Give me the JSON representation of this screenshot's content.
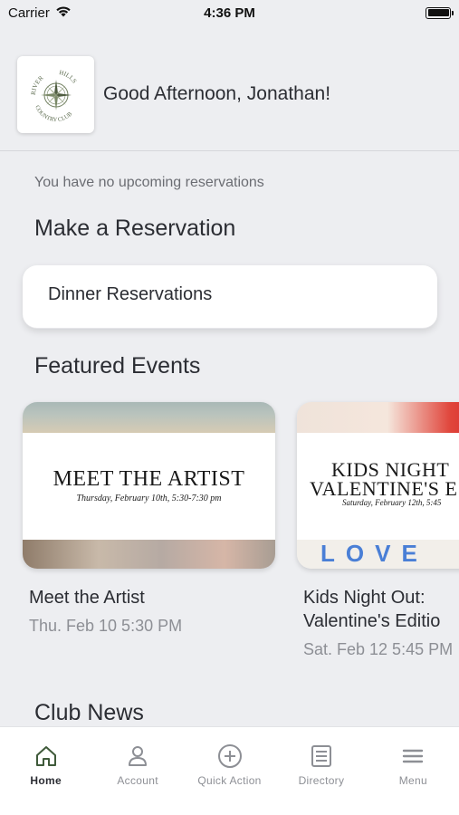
{
  "status": {
    "carrier": "Carrier",
    "time": "4:36 PM"
  },
  "header": {
    "greeting": "Good Afternoon, Jonathan!",
    "logo": {
      "top": "RIVER",
      "right": "HILLS",
      "bottom": "COUNTRY CLUB"
    }
  },
  "reservations": {
    "empty_text": "You have no upcoming reservations",
    "section_title": "Make a Reservation",
    "items": [
      {
        "label": "Dinner Reservations"
      }
    ]
  },
  "events": {
    "section_title": "Featured Events",
    "items": [
      {
        "banner_title": "MEET THE ARTIST",
        "banner_sub": "Thursday, February 10th, 5:30-7:30 pm",
        "name": "Meet the Artist",
        "date": "Thu. Feb 10 5:30 PM"
      },
      {
        "banner_title_1": "KIDS NIGHT",
        "banner_title_2": "VALENTINE'S E",
        "banner_sub": "Saturday, February 12th, 5:45",
        "banner_letters": "LOVE",
        "name_1": "Kids Night Out:",
        "name_2": "Valentine's Editio",
        "date": "Sat. Feb 12 5:45 PM"
      }
    ]
  },
  "news": {
    "section_title": "Club News"
  },
  "tabs": [
    {
      "label": "Home",
      "icon": "home-icon"
    },
    {
      "label": "Account",
      "icon": "user-icon"
    },
    {
      "label": "Quick Action",
      "icon": "plus-circle-icon"
    },
    {
      "label": "Directory",
      "icon": "directory-icon"
    },
    {
      "label": "Menu",
      "icon": "menu-icon"
    }
  ],
  "colors": {
    "background": "#edeef1",
    "text": "#2b2d33",
    "muted": "#8d8f95"
  }
}
